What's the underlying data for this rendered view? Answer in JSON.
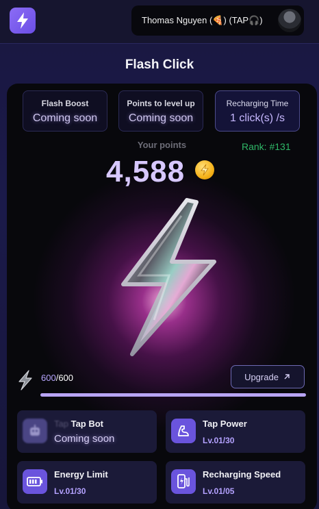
{
  "header": {
    "user_label": "Thomas Nguyen (🍕) (TAP🎧)"
  },
  "page_title": "Flash Click",
  "stats": [
    {
      "title": "Flash Boost",
      "value": "Coming soon"
    },
    {
      "title": "Points to level up",
      "value": "Coming soon"
    },
    {
      "title": "Recharging Time",
      "value": "1 click(s) /s"
    }
  ],
  "points": {
    "label": "Your points",
    "value": "4,588",
    "rank": "Rank: #131"
  },
  "energy": {
    "current": "600",
    "max": "/600",
    "fill_fraction": 1.0
  },
  "upgrade_label": "Upgrade",
  "features": [
    {
      "ghost": "Tap",
      "name": "Tap Bot",
      "status": "Coming soon",
      "icon": "robot-icon"
    },
    {
      "name": "Tap Power",
      "level": "Lv.01/30",
      "icon": "arm-icon"
    },
    {
      "name": "Energy Limit",
      "level": "Lv.01/30",
      "icon": "battery-icon"
    },
    {
      "name": "Recharging Speed",
      "level": "Lv.01/05",
      "icon": "charging-station-icon"
    }
  ],
  "colors": {
    "accent": "#6a54dd",
    "points": "#d7c8ff",
    "rank": "#2fb868"
  }
}
